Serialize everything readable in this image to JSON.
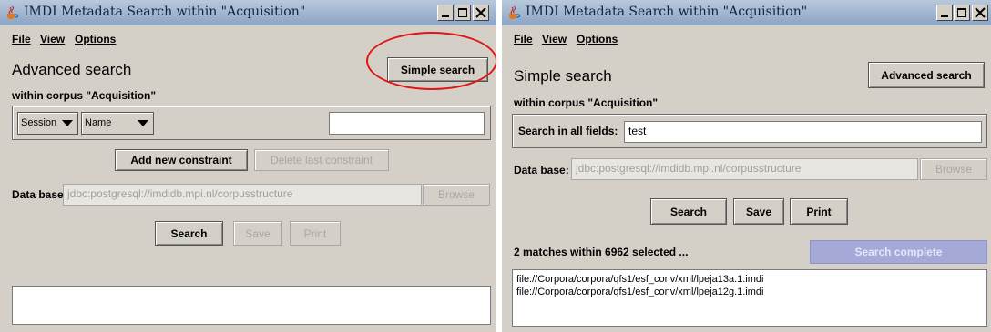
{
  "left": {
    "title": "IMDI Metadata Search within \"Acquisition\"",
    "menu": [
      "File",
      "View",
      "Options"
    ],
    "heading": "Advanced search",
    "toggle_button": "Simple search",
    "corpus_label": "within corpus \"Acquisition\"",
    "constraint": {
      "category": "Session",
      "field": "Name",
      "value": ""
    },
    "add_constraint": "Add new constraint",
    "delete_constraint": "Delete last constraint",
    "database_label": "Data base:",
    "database_value": "jdbc:postgresql://imdidb.mpi.nl/corpusstructure",
    "browse": "Browse",
    "search": "Search",
    "save": "Save",
    "print": "Print",
    "results": []
  },
  "right": {
    "title": "IMDI Metadata Search within \"Acquisition\"",
    "menu": [
      "File",
      "View",
      "Options"
    ],
    "heading": "Simple search",
    "toggle_button": "Advanced search",
    "corpus_label": "within corpus \"Acquisition\"",
    "search_all_label": "Search in all fields:",
    "search_all_value": "test",
    "database_label": "Data base:",
    "database_value": "jdbc:postgresql://imdidb.mpi.nl/corpusstructure",
    "browse": "Browse",
    "search": "Search",
    "save": "Save",
    "print": "Print",
    "status": "2 matches within 6962 selected ...",
    "progress_label": "Search complete",
    "progress": 1.0,
    "results": [
      "file://Corpora/corpora/qfs1/esf_conv/xml/lpeja13a.1.imdi",
      "file://Corpora/corpora/qfs1/esf_conv/xml/lpeja12g.1.imdi"
    ]
  },
  "annotation": {
    "color": "#e01616",
    "shape": "ellipse",
    "target": "Simple search"
  },
  "colors": {
    "window_bg": "#d4d0c8",
    "progress_fill": "#a5a9d8"
  }
}
